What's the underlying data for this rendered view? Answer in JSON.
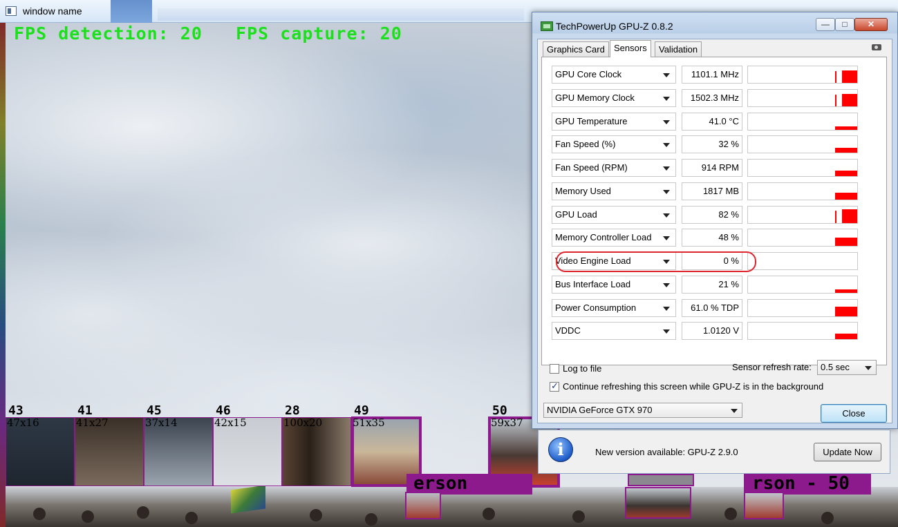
{
  "background_window": {
    "title": "window name",
    "fps_text": "FPS detection: 20   FPS capture: 20",
    "thumbnails": [
      {
        "id": "43",
        "size": "47x16"
      },
      {
        "id": "41",
        "size": "41x27"
      },
      {
        "id": "45",
        "size": "37x14"
      },
      {
        "id": "46",
        "size": "42x15"
      },
      {
        "id": "28",
        "size": "100x20"
      },
      {
        "id": "49",
        "size": "51x35"
      },
      {
        "id": "50",
        "size": "59x37"
      }
    ],
    "detection_labels": [
      "erson",
      "rson - 50"
    ]
  },
  "gpuz": {
    "title": "TechPowerUp GPU-Z 0.8.2",
    "minimize": "—",
    "maximize": "□",
    "close": "✕",
    "tabs": [
      "Graphics Card",
      "Sensors",
      "Validation"
    ],
    "sensors": [
      {
        "name": "GPU Core Clock",
        "value": "1101.1 MHz",
        "level": 0.75
      },
      {
        "name": "GPU Memory Clock",
        "value": "1502.3 MHz",
        "level": 0.75
      },
      {
        "name": "GPU Temperature",
        "value": "41.0 °C",
        "level": 0.2
      },
      {
        "name": "Fan Speed (%)",
        "value": "32 %",
        "level": 0.3
      },
      {
        "name": "Fan Speed (RPM)",
        "value": "914 RPM",
        "level": 0.35
      },
      {
        "name": "Memory Used",
        "value": "1817 MB",
        "level": 0.4
      },
      {
        "name": "GPU Load",
        "value": "82 %",
        "level": 0.82
      },
      {
        "name": "Memory Controller Load",
        "value": "48 %",
        "level": 0.48
      },
      {
        "name": "Video Engine Load",
        "value": "0 %",
        "level": 0
      },
      {
        "name": "Bus Interface Load",
        "value": "21 %",
        "level": 0.21
      },
      {
        "name": "Power Consumption",
        "value": "61.0 % TDP",
        "level": 0.6
      },
      {
        "name": "VDDC",
        "value": "1.0120 V",
        "level": 0.35
      }
    ],
    "log_to_file": "Log to file",
    "refresh_label": "Sensor refresh rate:",
    "refresh_value": "0.5 sec",
    "continue_refresh": "Continue refreshing this screen while GPU-Z is in the background",
    "gpu_select": "NVIDIA GeForce GTX 970",
    "close_button": "Close",
    "update_message": "New version available: GPU-Z 2.9.0",
    "update_button": "Update Now",
    "accent_highlight": "#e0242c",
    "graph_color": "#ff0000"
  }
}
